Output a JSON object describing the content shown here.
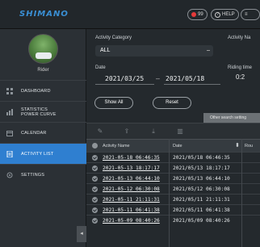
{
  "app": {
    "logo": "SHIMANO"
  },
  "header": {
    "notifications_label": "99",
    "help_label": "HELP"
  },
  "sidebar": {
    "username": "Rider",
    "items": [
      {
        "label": "DASHBOARD",
        "icon": "dashboard-icon"
      },
      {
        "label": "STATISTICS",
        "label2": "POWER CURVE",
        "icon": "statistics-icon"
      },
      {
        "label": "CALENDAR",
        "icon": "calendar-icon"
      },
      {
        "label": "ACTIVITY LIST",
        "icon": "activity-list-icon",
        "active": true
      },
      {
        "label": "SETTINGS",
        "icon": "settings-icon"
      }
    ],
    "collapse_label": "◂"
  },
  "filters": {
    "activity_category_label": "Activity Category",
    "activity_category_value": "ALL",
    "activity_name_label": "Activity Na",
    "date_label": "Date",
    "date_from": "2021/03/25",
    "date_sep": "–",
    "date_to": "2021/05/18",
    "riding_time_label": "Riding time",
    "riding_time_value": "0:2",
    "show_all": "Show All",
    "reset": "Reset",
    "other_search": "Other search setting"
  },
  "table": {
    "headers": {
      "name": "Activity Name",
      "date": "Date",
      "extra": "Rou"
    },
    "rows": [
      {
        "name": "2021-05-18 06:46:35",
        "date": "2021/05/18 06:46:35"
      },
      {
        "name": "2021-05-13 18:17:17",
        "date": "2021/05/13 18:17:17"
      },
      {
        "name": "2021-05-13 06:44:10",
        "date": "2021/05/13 06:44:10"
      },
      {
        "name": "2021-05-12 06:30:08",
        "date": "2021/05/12 06:30:08"
      },
      {
        "name": "2021-05-11 21:11:31",
        "date": "2021/05/11 21:11:31"
      },
      {
        "name": "2021-05-11 06:41:38",
        "date": "2021/05/11 06:41:38"
      },
      {
        "name": "2021-05-09 08:40:26",
        "date": "2021/05/09 08:40:26"
      }
    ]
  },
  "colors": {
    "accent": "#2f7fd0",
    "logo": "#3a8fd4",
    "alert": "#e63a3a"
  }
}
